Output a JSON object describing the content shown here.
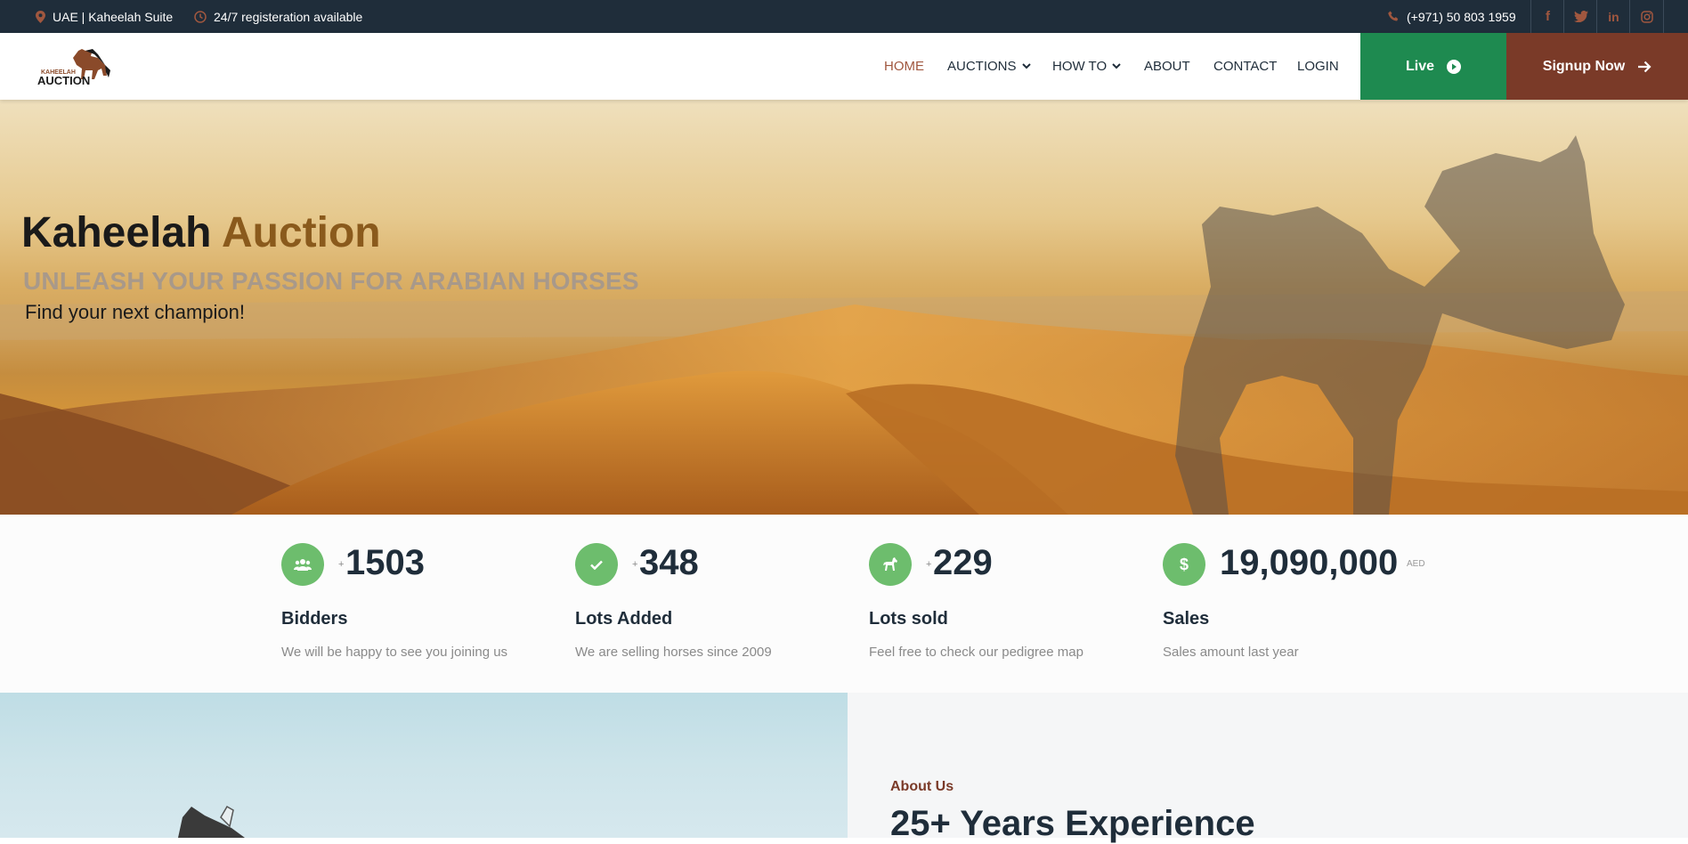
{
  "topbar": {
    "location_icon": "map-pin-icon",
    "location": "UAE | Kaheelah Suite",
    "registration_icon": "clock-icon",
    "registration": "24/7 registeration available",
    "phone_icon": "phone-icon",
    "phone": "(+971) 50 803 1959",
    "socials": [
      {
        "icon": "facebook-icon",
        "glyph": "f"
      },
      {
        "icon": "twitter-icon",
        "glyph": "🐦"
      },
      {
        "icon": "linkedin-icon",
        "glyph": "in"
      },
      {
        "icon": "instagram-icon",
        "glyph": "◎"
      }
    ]
  },
  "header": {
    "logo": {
      "small": "KAHEELAH",
      "large": "AUCTION"
    },
    "nav": {
      "home": "HOME",
      "auctions": "AUCTIONS",
      "howto": "HOW TO",
      "about": "ABOUT",
      "contact": "CONTACT",
      "login": "LOGIN"
    },
    "live_label": "Live",
    "signup_label": "Signup Now"
  },
  "hero": {
    "title_part1": "Kaheelah",
    "title_part2": "Auction",
    "subtitle": "UNLEASH YOUR PASSION FOR ARABIAN HORSES",
    "tagline": "Find your next champion!"
  },
  "stats": [
    {
      "icon": "users-icon",
      "prefix": "+",
      "value": "1503",
      "unit": "",
      "label": "Bidders",
      "desc": "We will be happy to see you joining us"
    },
    {
      "icon": "check-icon",
      "prefix": "+",
      "value": "348",
      "unit": "",
      "label": "Lots Added",
      "desc": "We are selling horses since 2009"
    },
    {
      "icon": "horse-icon",
      "prefix": "+",
      "value": "229",
      "unit": "",
      "label": "Lots sold",
      "desc": "Feel free to check our pedigree map"
    },
    {
      "icon": "dollar-icon",
      "prefix": "",
      "value": "19,090,000",
      "unit": "AED",
      "label": "Sales",
      "desc": "Sales amount last year"
    }
  ],
  "about": {
    "kicker": "About Us",
    "heading": "25+ Years Experience"
  },
  "colors": {
    "topbar_bg": "#1f2d3a",
    "accent_brown": "#7a3a28",
    "live_green": "#1e8a50",
    "stat_icon_green": "#6dbd6d"
  }
}
